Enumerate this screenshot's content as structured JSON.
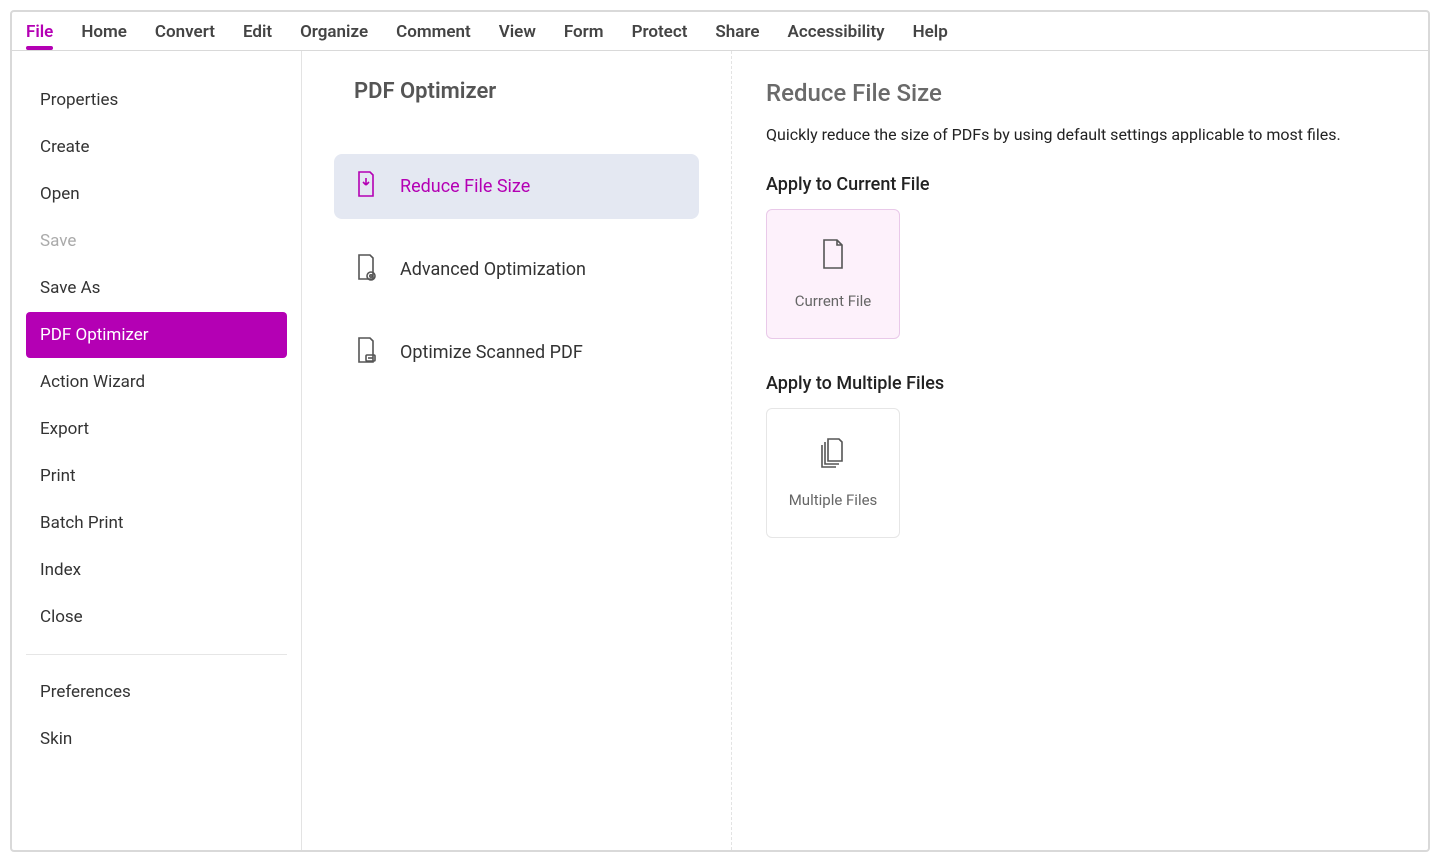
{
  "menubar": [
    {
      "label": "File",
      "active": true
    },
    {
      "label": "Home"
    },
    {
      "label": "Convert"
    },
    {
      "label": "Edit"
    },
    {
      "label": "Organize"
    },
    {
      "label": "Comment"
    },
    {
      "label": "View"
    },
    {
      "label": "Form"
    },
    {
      "label": "Protect"
    },
    {
      "label": "Share"
    },
    {
      "label": "Accessibility"
    },
    {
      "label": "Help"
    }
  ],
  "sidebar": {
    "group1": [
      {
        "label": "Properties"
      },
      {
        "label": "Create"
      },
      {
        "label": "Open"
      },
      {
        "label": "Save",
        "disabled": true
      },
      {
        "label": "Save As"
      },
      {
        "label": "PDF Optimizer",
        "selected": true
      },
      {
        "label": "Action Wizard"
      },
      {
        "label": "Export"
      },
      {
        "label": "Print"
      },
      {
        "label": "Batch Print"
      },
      {
        "label": "Index"
      },
      {
        "label": "Close"
      }
    ],
    "group2": [
      {
        "label": "Preferences"
      },
      {
        "label": "Skin"
      }
    ]
  },
  "middle": {
    "title": "PDF Optimizer",
    "options": [
      {
        "label": "Reduce File Size",
        "selected": true,
        "icon": "reduce"
      },
      {
        "label": "Advanced Optimization",
        "icon": "advanced"
      },
      {
        "label": "Optimize Scanned PDF",
        "icon": "scanned"
      }
    ]
  },
  "right": {
    "title": "Reduce File Size",
    "description": "Quickly reduce the size of PDFs by using default settings applicable to most files.",
    "section1_label": "Apply to Current File",
    "card1_label": "Current File",
    "section2_label": "Apply to Multiple Files",
    "card2_label": "Multiple Files"
  }
}
